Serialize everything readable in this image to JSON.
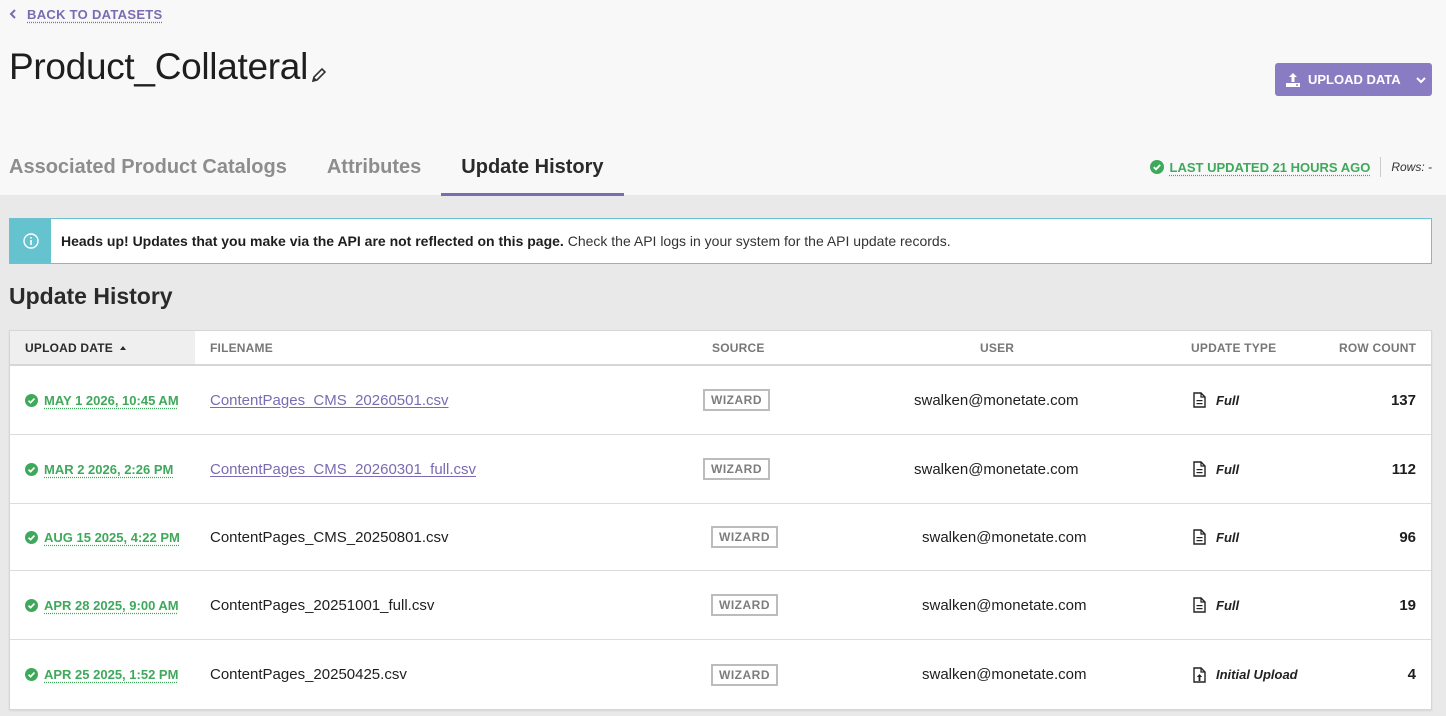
{
  "nav": {
    "back_label": "BACK TO DATASETS"
  },
  "dataset": {
    "title": "Product_Collateral"
  },
  "actions": {
    "upload_label": "UPLOAD DATA"
  },
  "tabs": [
    {
      "label": "Associated Product Catalogs",
      "active": false
    },
    {
      "label": "Attributes",
      "active": false
    },
    {
      "label": "Update History",
      "active": true
    }
  ],
  "status": {
    "last_updated": "LAST UPDATED 21 HOURS AGO",
    "rows": "Rows: -"
  },
  "banner": {
    "bold": "Heads up! Updates that you make via the API are not reflected on this page.",
    "text": " Check the API logs in your system for the API update records."
  },
  "section": {
    "title": "Update History"
  },
  "table": {
    "headers": {
      "upload_date": "UPLOAD DATE",
      "filename": "FILENAME",
      "source": "SOURCE",
      "user": "USER",
      "update_type": "UPDATE TYPE",
      "row_count": "ROW COUNT"
    },
    "rows": [
      {
        "date": "MAY 1 2026, 10:45 AM",
        "filename": "ContentPages_CMS_20260501.csv",
        "link": true,
        "source": "WIZARD",
        "user": "swalken@monetate.com",
        "type": "Full",
        "count": "137"
      },
      {
        "date": "MAR 2 2026, 2:26 PM",
        "filename": "ContentPages_CMS_20260301_full.csv",
        "link": true,
        "source": "WIZARD",
        "user": "swalken@monetate.com",
        "type": "Full",
        "count": "112"
      },
      {
        "date": "AUG 15 2025, 4:22 PM",
        "filename": "ContentPages_CMS_20250801.csv",
        "link": false,
        "source": "WIZARD",
        "user": "swalken@monetate.com",
        "type": "Full",
        "count": "96"
      },
      {
        "date": "APR 28 2025, 9:00 AM",
        "filename": "ContentPages_20251001_full.csv",
        "link": false,
        "source": "WIZARD",
        "user": "swalken@monetate.com",
        "type": "Full",
        "count": "19"
      },
      {
        "date": "APR 25 2025, 1:52 PM",
        "filename": "ContentPages_20250425.csv",
        "link": false,
        "source": "WIZARD",
        "user": "swalken@monetate.com",
        "type": "Initial Upload",
        "count": "4"
      }
    ]
  },
  "colors": {
    "accent": "#8a7cc2",
    "success": "#3fa95b",
    "info": "#64c3cf"
  }
}
